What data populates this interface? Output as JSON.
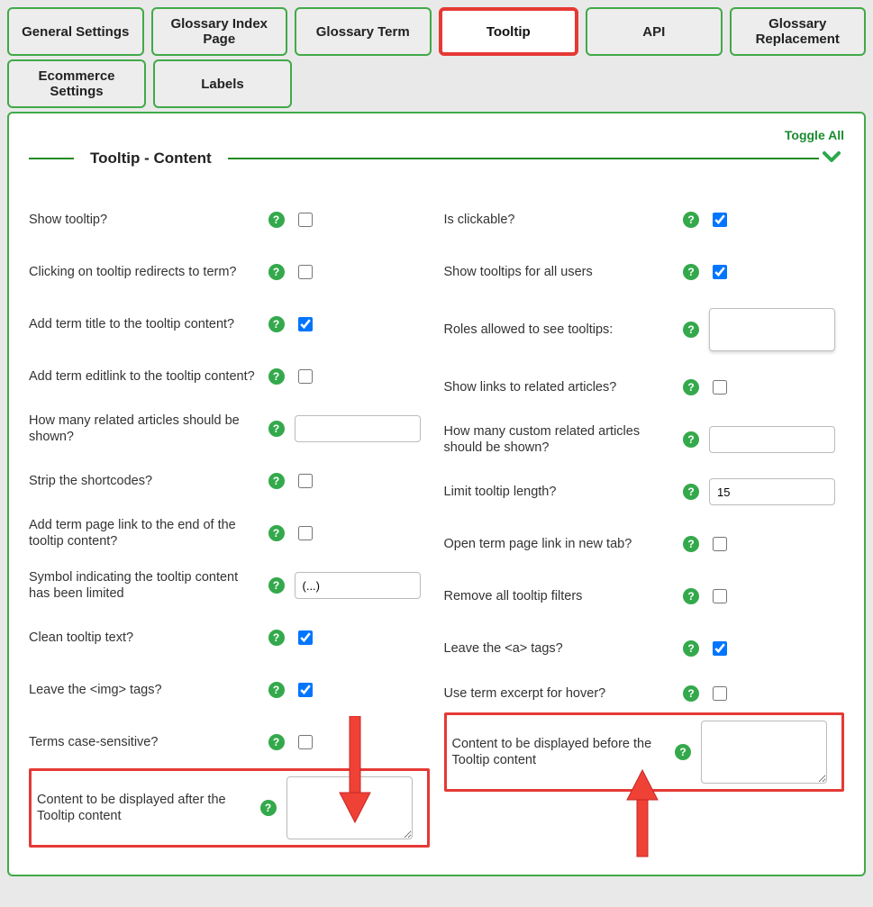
{
  "tabs": {
    "row1": [
      {
        "label": "General Settings"
      },
      {
        "label": "Glossary Index Page"
      },
      {
        "label": "Glossary Term"
      },
      {
        "label": "Tooltip",
        "active": true
      },
      {
        "label": "API"
      },
      {
        "label": "Glossary Replacement"
      }
    ],
    "row2": [
      {
        "label": "Ecommerce Settings"
      },
      {
        "label": "Labels"
      }
    ]
  },
  "panel": {
    "toggle_all": "Toggle All",
    "section_title": "Tooltip - Content"
  },
  "left": [
    {
      "label": "Show tooltip?",
      "type": "checkbox",
      "checked": false
    },
    {
      "label": "Clicking on tooltip redirects to term?",
      "type": "checkbox",
      "checked": false
    },
    {
      "label": "Add term title to the tooltip content?",
      "type": "checkbox",
      "checked": true
    },
    {
      "label": "Add term editlink to the tooltip content?",
      "type": "checkbox",
      "checked": false
    },
    {
      "label": "How many related articles should be shown?",
      "type": "text",
      "value": ""
    },
    {
      "label": "Strip the shortcodes?",
      "type": "checkbox",
      "checked": false
    },
    {
      "label": "Add term page link to the end of the tooltip content?",
      "type": "checkbox",
      "checked": false
    },
    {
      "label": "Symbol indicating the tooltip content has been limited",
      "type": "text",
      "value": "(...)"
    },
    {
      "label": "Clean tooltip text?",
      "type": "checkbox",
      "checked": true
    },
    {
      "label": "Leave the <img> tags?",
      "type": "checkbox",
      "checked": true
    },
    {
      "label": "Terms case-sensitive?",
      "type": "checkbox",
      "checked": false
    },
    {
      "label": "Content to be displayed after the Tooltip content",
      "type": "textarea",
      "value": "",
      "highlight": true
    }
  ],
  "right": [
    {
      "label": "Is clickable?",
      "type": "checkbox",
      "checked": true
    },
    {
      "label": "Show tooltips for all users",
      "type": "checkbox",
      "checked": true
    },
    {
      "label": "Roles allowed to see tooltips:",
      "type": "roles",
      "value": ""
    },
    {
      "label": "Show links to related articles?",
      "type": "checkbox",
      "checked": false
    },
    {
      "label": "How many custom related articles should be shown?",
      "type": "text",
      "value": ""
    },
    {
      "label": "Limit tooltip length?",
      "type": "text",
      "value": "15"
    },
    {
      "label": "Open term page link in new tab?",
      "type": "checkbox",
      "checked": false
    },
    {
      "label": "Remove all tooltip filters",
      "type": "checkbox",
      "checked": false
    },
    {
      "label": "Leave the <a> tags?",
      "type": "checkbox",
      "checked": true
    },
    {
      "label": "Use term excerpt for hover?",
      "type": "checkbox",
      "checked": false
    },
    {
      "label": "Content to be displayed before the Tooltip content",
      "type": "textarea",
      "value": "",
      "highlight": true
    }
  ]
}
